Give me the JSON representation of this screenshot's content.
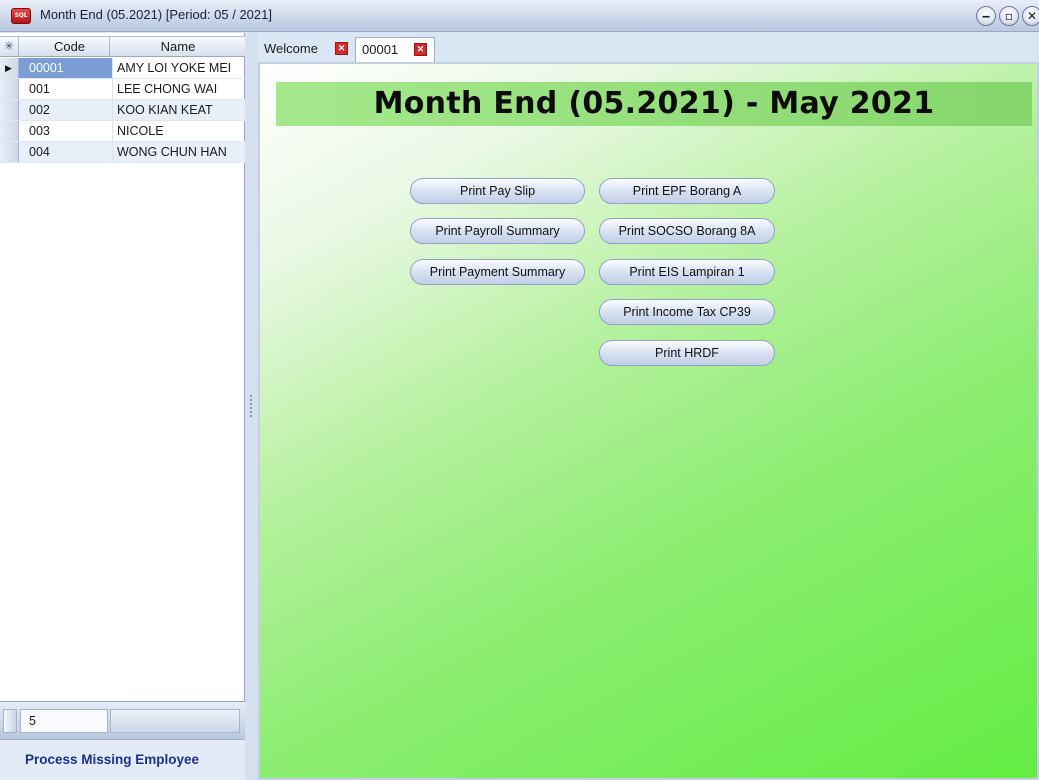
{
  "window": {
    "title": "Month End (05.2021) [Period: 05 / 2021]",
    "app_icon_label": "SQL"
  },
  "grid": {
    "columns": {
      "code": "Code",
      "name": "Name"
    },
    "rows": [
      {
        "code": "00001",
        "name": "AMY LOI YOKE MEI",
        "selected": true
      },
      {
        "code": "001",
        "name": "LEE CHONG WAI"
      },
      {
        "code": "002",
        "name": "KOO KIAN KEAT"
      },
      {
        "code": "003",
        "name": "NICOLE"
      },
      {
        "code": "004",
        "name": "WONG CHUN HAN"
      }
    ],
    "record_count": "5"
  },
  "actions": {
    "process_missing": "Process Missing Employee"
  },
  "tabs": [
    {
      "label": "Welcome"
    },
    {
      "label": "00001"
    }
  ],
  "main": {
    "banner_title": "Month End (05.2021) - May 2021",
    "buttons_left": [
      "Print Pay Slip",
      "Print Payroll Summary",
      "Print Payment Summary"
    ],
    "buttons_right": [
      "Print EPF Borang A",
      "Print SOCSO Borang 8A",
      "Print EIS Lampiran 1",
      "Print Income Tax CP39",
      "Print HRDF"
    ]
  }
}
